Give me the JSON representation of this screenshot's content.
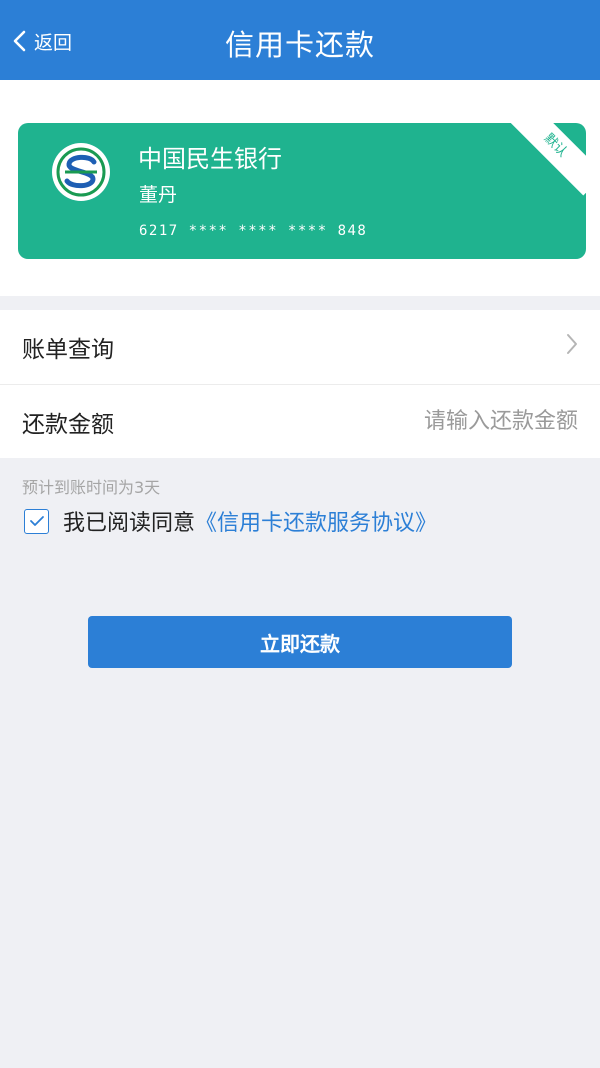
{
  "navbar": {
    "back_label": "返回",
    "title": "信用卡还款",
    "back_icon": "chevron-left-icon",
    "color": "#2c7fd6"
  },
  "card": {
    "bank_name": "中国民生银行",
    "holder": "董丹",
    "number": "6217 **** **** **** 848",
    "default_badge": "默认",
    "logo_icon": "minsheng-bank-logo",
    "color": "#1fb38f"
  },
  "menu": {
    "bill_query_label": "账单查询",
    "amount_label": "还款金额",
    "amount_placeholder": "请输入还款金额",
    "amount_value": ""
  },
  "hint": "预计到账时间为3天",
  "agreement": {
    "checked": true,
    "text": "我已阅读同意",
    "link": "《信用卡还款服务协议》"
  },
  "submit_label": "立即还款"
}
